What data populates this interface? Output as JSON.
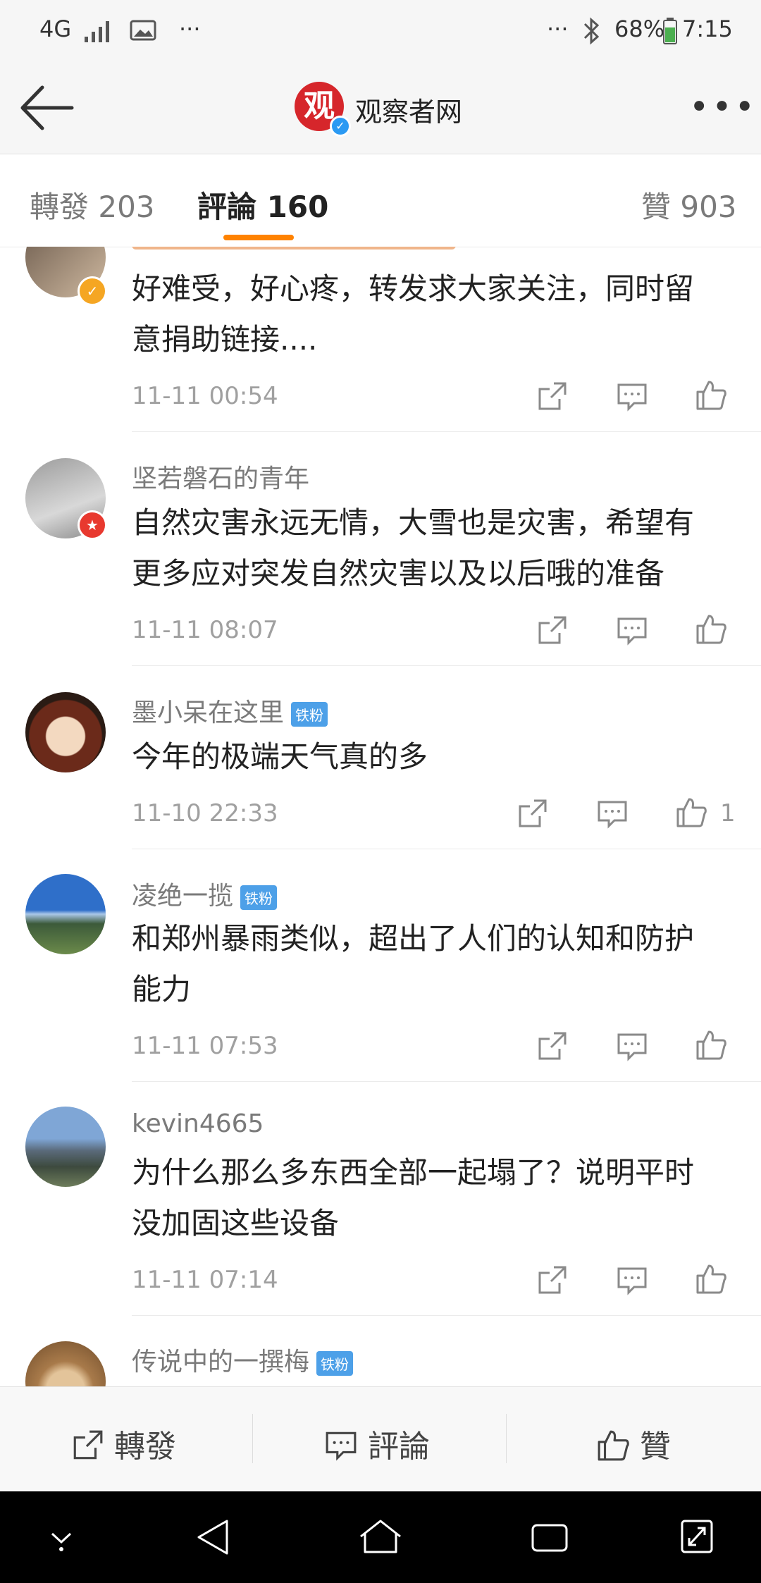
{
  "status_bar": {
    "network": "4G",
    "dots_left": "···",
    "dots_right": "···",
    "battery": "68%",
    "time": "7:15"
  },
  "header": {
    "logo_char": "观",
    "title": "观察者网"
  },
  "tabs": [
    {
      "label": "轉發 203"
    },
    {
      "label": "評論 160"
    },
    {
      "label": "贊 903"
    }
  ],
  "comments": [
    {
      "username": "",
      "text_line1": "好难受，好心疼，转发求大家关注，同时留",
      "text_line2": "意捐助链接....",
      "time": "11-11 00:54",
      "likes": ""
    },
    {
      "username": "坚若磐石的青年",
      "text_line1": "自然灾害永远无情，大雪也是灾害，希望有",
      "text_line2": "更多应对突发自然灾害以及以后哦的准备",
      "time": "11-11 08:07",
      "likes": ""
    },
    {
      "username": "墨小呆在这里",
      "fan_badge": "铁粉",
      "text_line1": "今年的极端天气真的多",
      "time": "11-10 22:33",
      "likes": "1"
    },
    {
      "username": "凌绝一揽",
      "fan_badge": "铁粉",
      "text_line1": "和郑州暴雨类似，超出了人们的认知和防护",
      "text_line2": "能力",
      "time": "11-11 07:53",
      "likes": ""
    },
    {
      "username": "kevin4665",
      "text_line1": "为什么那么多东西全部一起塌了？说明平时",
      "text_line2": "没加固这些设备",
      "time": "11-11 07:14",
      "likes": ""
    },
    {
      "username": "传说中的一撰梅",
      "fan_badge": "铁粉"
    }
  ],
  "bottom_bar": {
    "repost": "轉發",
    "comment": "評論",
    "like": "贊"
  },
  "colors": {
    "accent": "#ff8200",
    "fan_badge": "#4da0e8",
    "verified_blue": "#2b9af3",
    "logo_red": "#d6262b"
  },
  "icons": [
    "back-arrow-icon",
    "more-icon",
    "share-icon",
    "comment-icon",
    "like-icon",
    "bluetooth-icon",
    "signal-icon",
    "battery-icon"
  ]
}
